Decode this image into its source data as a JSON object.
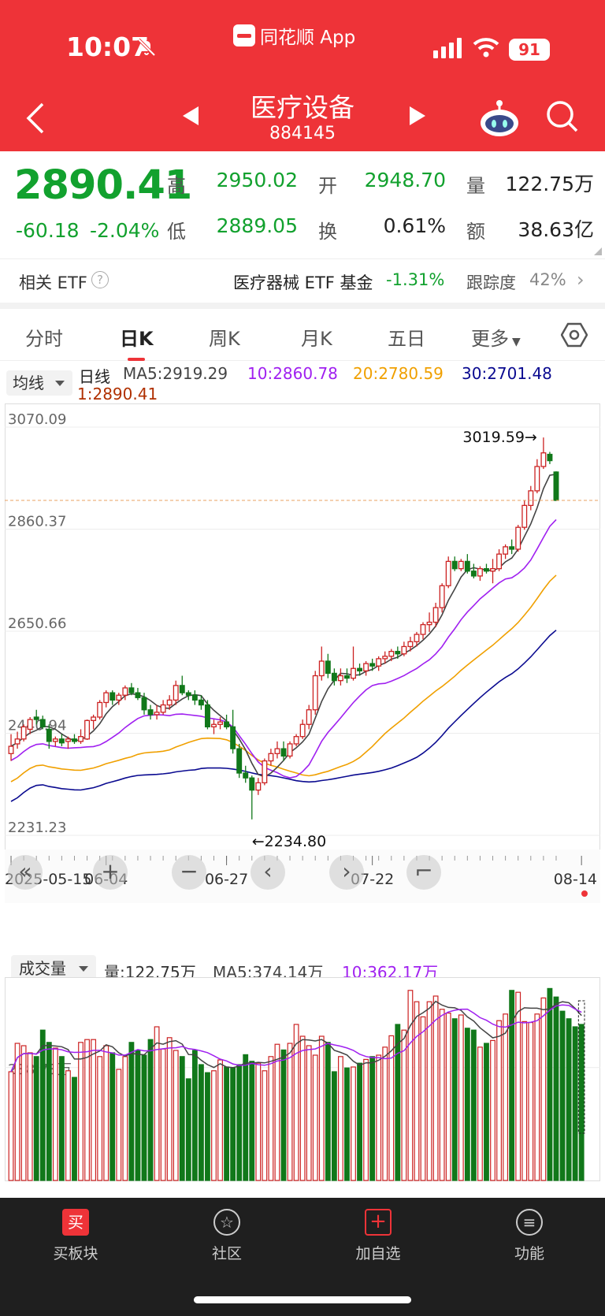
{
  "status": {
    "time": "10:07",
    "app_name": "同花顺 App",
    "battery": "91"
  },
  "header": {
    "title": "医疗设备",
    "code": "884145"
  },
  "quote": {
    "price": "2890.41",
    "change": "-60.18",
    "change_pct": "-2.04%",
    "high_label": "高",
    "high": "2950.02",
    "open_label": "开",
    "open": "2948.70",
    "volume_label": "量",
    "volume": "122.75万",
    "low_label": "低",
    "low": "2889.05",
    "turnover_label": "换",
    "turnover": "0.61%",
    "amount_label": "额",
    "amount": "38.63亿"
  },
  "etf": {
    "label": "相关 ETF",
    "fund": "医疗器械 ETF 基金",
    "fund_pct": "-1.31%",
    "track_label": "跟踪度",
    "track_value": "42%"
  },
  "tabs": [
    "分时",
    "日K",
    "周K",
    "月K",
    "五日",
    "更多"
  ],
  "active_tab": 1,
  "ma_bar": {
    "button": "均线",
    "period": "日线",
    "ma5": "MA5:2919.29",
    "ma10": "10:2860.78",
    "ma20": "20:2780.59",
    "ma30": "30:2701.48",
    "ma1": "1:2890.41"
  },
  "colors": {
    "up": "#cc2222",
    "down": "#11781a",
    "ma5": "#444444",
    "ma10": "#a020f0",
    "ma20": "#f0a000",
    "ma30": "#0a0a90",
    "brand": "#ee3338"
  },
  "chart_data": [
    {
      "type": "candlestick",
      "title": "",
      "y_ticks": [
        "3070.09",
        "2860.37",
        "2650.66",
        "2440.94",
        "2231.23"
      ],
      "ylim": [
        2231.23,
        3070.09
      ],
      "x_ticks": [
        "2025-05-15",
        "06-04",
        "06-27",
        "07-22",
        "08-14"
      ],
      "annotations": {
        "high_marker": "3019.59→",
        "low_marker": "←2234.80"
      },
      "last_close_line": 2890.41,
      "ohlc": [
        [
          2370,
          2410,
          2355,
          2385
        ],
        [
          2390,
          2415,
          2380,
          2400
        ],
        [
          2400,
          2430,
          2395,
          2425
        ],
        [
          2420,
          2445,
          2410,
          2440
        ],
        [
          2445,
          2460,
          2430,
          2440
        ],
        [
          2440,
          2448,
          2420,
          2425
        ],
        [
          2420,
          2430,
          2380,
          2395
        ],
        [
          2395,
          2405,
          2385,
          2400
        ],
        [
          2400,
          2410,
          2385,
          2392
        ],
        [
          2395,
          2405,
          2380,
          2400
        ],
        [
          2400,
          2410,
          2390,
          2395
        ],
        [
          2395,
          2420,
          2390,
          2405
        ],
        [
          2400,
          2440,
          2398,
          2438
        ],
        [
          2438,
          2450,
          2420,
          2445
        ],
        [
          2445,
          2480,
          2440,
          2475
        ],
        [
          2475,
          2500,
          2465,
          2495
        ],
        [
          2495,
          2500,
          2470,
          2480
        ],
        [
          2480,
          2495,
          2470,
          2490
        ],
        [
          2490,
          2510,
          2480,
          2505
        ],
        [
          2505,
          2515,
          2490,
          2495
        ],
        [
          2495,
          2505,
          2480,
          2485
        ],
        [
          2485,
          2495,
          2450,
          2460
        ],
        [
          2460,
          2470,
          2440,
          2450
        ],
        [
          2450,
          2470,
          2440,
          2455
        ],
        [
          2455,
          2480,
          2450,
          2470
        ],
        [
          2470,
          2490,
          2460,
          2480
        ],
        [
          2480,
          2520,
          2470,
          2510
        ],
        [
          2510,
          2530,
          2490,
          2495
        ],
        [
          2495,
          2500,
          2480,
          2490
        ],
        [
          2490,
          2500,
          2470,
          2480
        ],
        [
          2480,
          2490,
          2460,
          2470
        ],
        [
          2470,
          2480,
          2420,
          2425
        ],
        [
          2425,
          2440,
          2410,
          2430
        ],
        [
          2430,
          2445,
          2420,
          2435
        ],
        [
          2435,
          2450,
          2420,
          2425
        ],
        [
          2425,
          2460,
          2370,
          2380
        ],
        [
          2380,
          2390,
          2320,
          2330
        ],
        [
          2330,
          2345,
          2310,
          2320
        ],
        [
          2320,
          2325,
          2234.8,
          2295
        ],
        [
          2295,
          2320,
          2285,
          2310
        ],
        [
          2310,
          2360,
          2305,
          2355
        ],
        [
          2355,
          2380,
          2345,
          2370
        ],
        [
          2370,
          2395,
          2360,
          2380
        ],
        [
          2380,
          2395,
          2355,
          2365
        ],
        [
          2365,
          2395,
          2360,
          2390
        ],
        [
          2390,
          2410,
          2385,
          2405
        ],
        [
          2405,
          2440,
          2400,
          2430
        ],
        [
          2430,
          2470,
          2420,
          2460
        ],
        [
          2460,
          2540,
          2450,
          2530
        ],
        [
          2530,
          2590,
          2520,
          2560
        ],
        [
          2560,
          2575,
          2525,
          2535
        ],
        [
          2535,
          2545,
          2510,
          2520
        ],
        [
          2520,
          2545,
          2510,
          2530
        ],
        [
          2530,
          2545,
          2515,
          2525
        ],
        [
          2525,
          2590,
          2520,
          2545
        ],
        [
          2545,
          2555,
          2530,
          2540
        ],
        [
          2540,
          2560,
          2530,
          2555
        ],
        [
          2555,
          2565,
          2540,
          2550
        ],
        [
          2550,
          2570,
          2540,
          2565
        ],
        [
          2565,
          2580,
          2555,
          2570
        ],
        [
          2570,
          2585,
          2560,
          2580
        ],
        [
          2580,
          2590,
          2565,
          2575
        ],
        [
          2575,
          2600,
          2570,
          2590
        ],
        [
          2590,
          2610,
          2580,
          2600
        ],
        [
          2600,
          2620,
          2590,
          2615
        ],
        [
          2615,
          2640,
          2605,
          2635
        ],
        [
          2635,
          2660,
          2620,
          2640
        ],
        [
          2640,
          2680,
          2630,
          2670
        ],
        [
          2670,
          2720,
          2660,
          2715
        ],
        [
          2715,
          2775,
          2710,
          2765
        ],
        [
          2765,
          2775,
          2745,
          2750
        ],
        [
          2750,
          2770,
          2745,
          2765
        ],
        [
          2765,
          2780,
          2740,
          2745
        ],
        [
          2745,
          2760,
          2730,
          2735
        ],
        [
          2735,
          2755,
          2725,
          2750
        ],
        [
          2750,
          2760,
          2740,
          2745
        ],
        [
          2745,
          2770,
          2720,
          2750
        ],
        [
          2750,
          2790,
          2745,
          2780
        ],
        [
          2780,
          2800,
          2770,
          2795
        ],
        [
          2795,
          2810,
          2780,
          2790
        ],
        [
          2790,
          2840,
          2785,
          2835
        ],
        [
          2835,
          2890,
          2830,
          2880
        ],
        [
          2880,
          2920,
          2870,
          2910
        ],
        [
          2910,
          2975,
          2905,
          2960
        ],
        [
          2960,
          3019.59,
          2955,
          2988
        ],
        [
          2985,
          2990,
          2965,
          2972
        ],
        [
          2948.7,
          2950.02,
          2889.05,
          2890.41
        ]
      ]
    },
    {
      "type": "bar",
      "title": "",
      "label_button": "成交量",
      "volume_text": "量:122.75万",
      "ma5_text": "MA5:374.14万",
      "ma10_text": "10:362.17万",
      "y_ticks": [
        "238.73万"
      ],
      "values": [
        230,
        290,
        285,
        270,
        262,
        318,
        292,
        280,
        262,
        232,
        218,
        292,
        298,
        298,
        262,
        285,
        270,
        235,
        262,
        292,
        275,
        265,
        298,
        325,
        278,
        302,
        275,
        262,
        215,
        275,
        245,
        228,
        232,
        255,
        240,
        238,
        245,
        266,
        252,
        248,
        232,
        262,
        288,
        276,
        290,
        330,
        305,
        285,
        265,
        305,
        292,
        230,
        262,
        238,
        240,
        248,
        256,
        262,
        265,
        282,
        306,
        330,
        318,
        402,
        378,
        346,
        378,
        390,
        362,
        354,
        342,
        350,
        322,
        318,
        282,
        290,
        296,
        338,
        352,
        402,
        398,
        336,
        334,
        352,
        386,
        406,
        388,
        358,
        342,
        325,
        330
      ]
    }
  ],
  "controls": [
    "«",
    "+",
    "−",
    "‹",
    "›",
    "⌐"
  ],
  "footer": [
    "买板块",
    "社区",
    "加自选",
    "功能"
  ]
}
